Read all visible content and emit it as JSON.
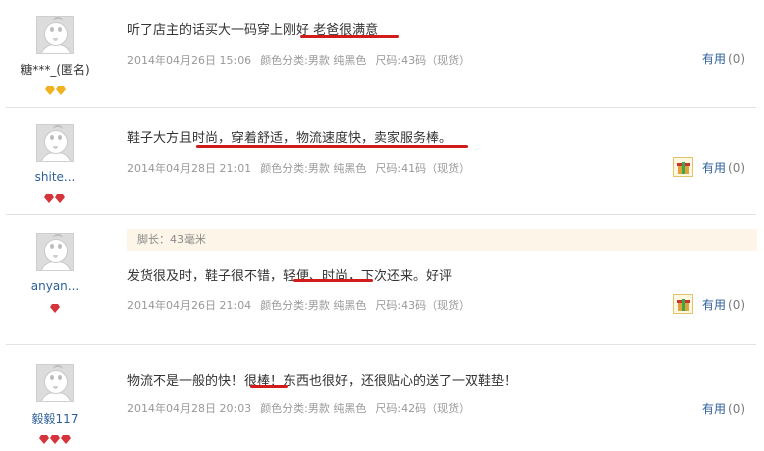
{
  "reviews": [
    {
      "user": "糖***_(匿名)",
      "comment": "听了店主的话买大一码穿上刚好 老爸很满意",
      "date": "2014年04月26日 15:06",
      "color": "颜色分类:男款 纯黑色",
      "size": "尺码:43码（现货）",
      "helpful_label": "有用",
      "helpful_count": "(0)",
      "badge": "yellow-diamond",
      "badge_count": 2
    },
    {
      "user": "shite...",
      "comment": "鞋子大方且时尚，穿着舒适，物流速度快，卖家服务棒。",
      "date": "2014年04月28日 21:01",
      "color": "颜色分类:男款 纯黑色",
      "size": "尺码:41码（现货）",
      "helpful_label": "有用",
      "helpful_count": "(0)",
      "badge": "red-heart",
      "badge_count": 2,
      "has_gift_icon": true
    },
    {
      "user": "anyan...",
      "extra": "脚长：43毫米",
      "comment": "发货很及时，鞋子很不错，轻便、时尚，下次还来。好评",
      "date": "2014年04月26日 21:04",
      "color": "颜色分类:男款 纯黑色",
      "size": "尺码:43码（现货）",
      "helpful_label": "有用",
      "helpful_count": "(0)",
      "badge": "red-heart",
      "badge_count": 1,
      "has_gift_icon": true
    },
    {
      "user": "毅毅117",
      "comment": "物流不是一般的快！很棒！东西也很好，还很贴心的送了一双鞋垫！",
      "date": "2014年04月28日 20:03",
      "color": "颜色分类:男款 纯黑色",
      "size": "尺码:42码（现货）",
      "helpful_label": "有用",
      "helpful_count": "(0)",
      "badge": "red-heart",
      "badge_count": 3
    }
  ],
  "colors": {
    "link": "#2d5f9a",
    "underline": "#d21b1b",
    "meta": "#999999"
  }
}
